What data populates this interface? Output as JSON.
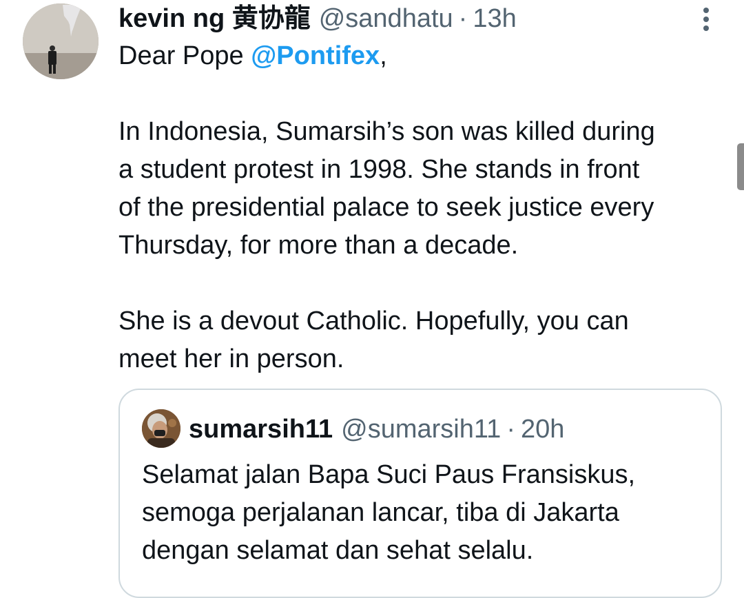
{
  "tweet": {
    "author": {
      "display_name": "kevin ng 黄协龍",
      "handle": "@sandhatu",
      "separator": "·",
      "time": "13h"
    },
    "text": {
      "line1_prefix": "Dear Pope ",
      "mention": "@Pontifex",
      "line1_suffix": ",",
      "para2": [
        "In Indonesia, Sumarsih’s son was killed during",
        "a student protest in 1998. She stands in front",
        "of the presidential palace to seek justice every",
        "Thursday, for more than a decade."
      ],
      "para3": [
        "She is a devout Catholic. Hopefully, you can",
        "meet her in person."
      ]
    },
    "more_icon": "more-vertical-icon",
    "quote": {
      "display_name": "sumarsih11",
      "handle": "@sumarsih11",
      "separator": "·",
      "time": "20h",
      "lines": [
        "Selamat jalan Bapa Suci Paus Fransiskus,",
        "semoga perjalanan lancar, tiba di Jakarta",
        "dengan selamat dan sehat selalu."
      ]
    }
  },
  "colors": {
    "text": "#0f1419",
    "secondary": "#536471",
    "link": "#1d9bf0",
    "border": "#cfd9de"
  }
}
